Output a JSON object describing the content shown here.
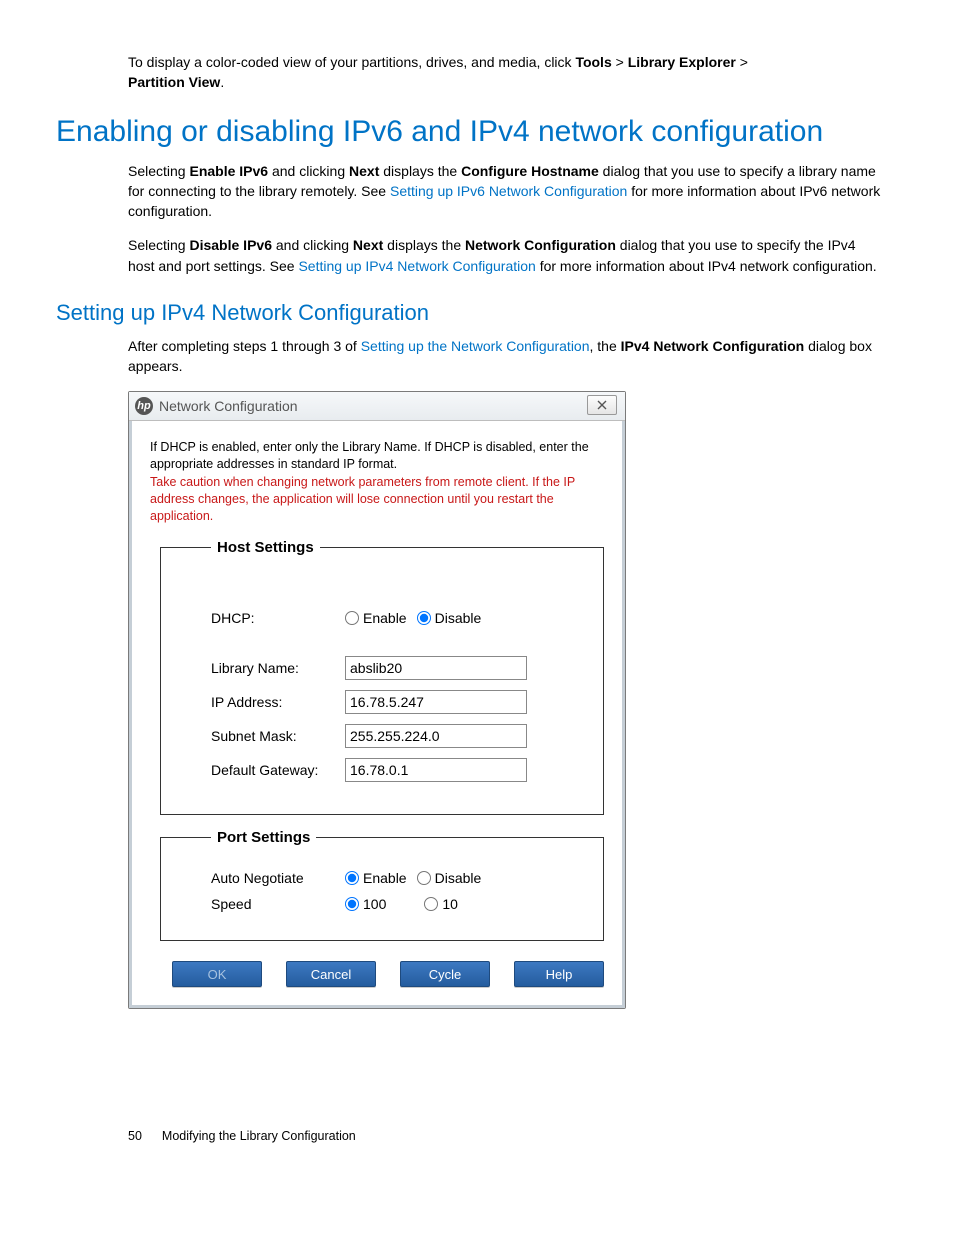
{
  "intro": {
    "pre": "To display a color-coded view of your partitions, drives, and media, click ",
    "tools": "Tools",
    "gt1": " > ",
    "libexp": "Library Explorer",
    "gt2": " > ",
    "pview": "Partition View",
    "period": "."
  },
  "h1": "Enabling or disabling IPv6 and IPv4 network configuration",
  "p1": {
    "a": "Selecting ",
    "enable": "Enable IPv6",
    "b": " and clicking ",
    "next": "Next",
    "c": " displays the ",
    "confhost": "Configure Hostname",
    "d": " dialog that you use to specify a library name for connecting to the library remotely. See ",
    "link": "Setting up IPv6 Network Configuration",
    "e": " for more information about IPv6 network configuration."
  },
  "p2": {
    "a": "Selecting ",
    "disable": "Disable IPv6",
    "b": " and clicking ",
    "next": "Next",
    "c": " displays the ",
    "netconf": "Network Configuration",
    "d": " dialog that you use to specify the IPv4 host and port settings. See ",
    "link": "Setting up IPv4 Network Configuration",
    "e": " for more information about IPv4 network configuration."
  },
  "h2": "Setting up IPv4 Network Configuration",
  "p3": {
    "a": "After completing steps 1 through 3 of ",
    "link": "Setting up the Network Configuration",
    "b": ", the ",
    "bold": "IPv4 Network Configuration",
    "c": " dialog box appears."
  },
  "dialog": {
    "title": "Network Configuration",
    "instr": "If DHCP is enabled, enter only the Library Name. If DHCP is disabled, enter the appropriate addresses in standard IP format.",
    "warn": "Take caution when changing network parameters from remote client. If the IP address changes, the application will lose connection until you restart the application.",
    "host_legend": "Host Settings",
    "port_legend": "Port Settings",
    "labels": {
      "dhcp": "DHCP:",
      "libname": "Library Name:",
      "ip": "IP Address:",
      "subnet": "Subnet Mask:",
      "gateway": "Default Gateway:",
      "auto": "Auto Negotiate",
      "speed": "Speed"
    },
    "values": {
      "libname": "abslib20",
      "ip": "16.78.5.247",
      "subnet": "255.255.224.0",
      "gateway": "16.78.0.1"
    },
    "options": {
      "enable": "Enable",
      "disable": "Disable",
      "s100": "100",
      "s10": "10"
    },
    "buttons": {
      "ok": "OK",
      "cancel": "Cancel",
      "cycle": "Cycle",
      "help": "Help"
    }
  },
  "footer": {
    "page": "50",
    "chapter": "Modifying the Library Configuration"
  }
}
